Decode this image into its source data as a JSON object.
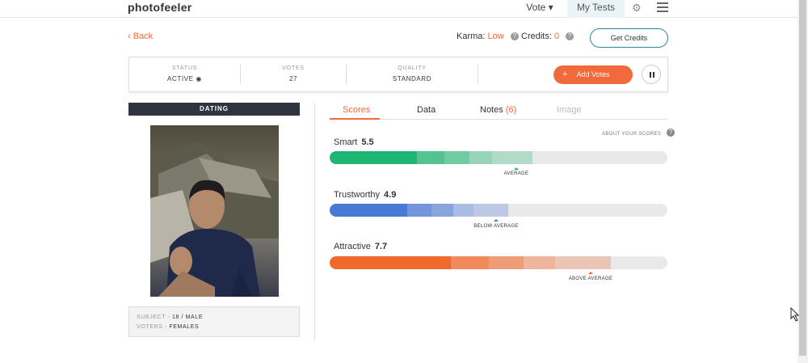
{
  "nav": {
    "logo": "photofeeler",
    "vote_label": "Vote ▾",
    "my_tests_label": "My Tests"
  },
  "header": {
    "back_label": "‹ Back",
    "karma_label": "Karma:",
    "karma_value": "Low",
    "credits_label": "Credits:",
    "credits_value": "0",
    "get_credits_label": "Get Credits"
  },
  "status": {
    "status_label": "STATUS",
    "status_value": "ACTIVE",
    "votes_label": "VOTES",
    "votes_value": "27",
    "quality_label": "QUALITY",
    "quality_value": "STANDARD",
    "add_votes_label": "Add Votes"
  },
  "photo": {
    "category": "DATING",
    "subject_label": "SUBJECT -",
    "subject_value": "18 / MALE",
    "voters_label": "VOTERS -",
    "voters_value": "FEMALES"
  },
  "tabs": {
    "scores": "Scores",
    "data": "Data",
    "notes": "Notes",
    "notes_count": "(6)",
    "image": "Image",
    "about_scores": "ABOUT YOUR SCORES"
  },
  "scores": [
    {
      "name": "Smart",
      "value": "5.5",
      "marker_label": "AVERAGE",
      "color": "#1fb573",
      "level": 0.555
    },
    {
      "name": "Trustworthy",
      "value": "4.9",
      "marker_label": "BELOW AVERAGE",
      "color": "#4a78d6",
      "level": 0.49
    },
    {
      "name": "Attractive",
      "value": "7.7",
      "marker_label": "ABOVE AVERAGE",
      "color": "#f26a2b",
      "level": 0.77
    }
  ],
  "colors": {
    "accent": "#f26a3b",
    "category_bg": "#303440",
    "get_credits_border": "#2c8a9a"
  }
}
